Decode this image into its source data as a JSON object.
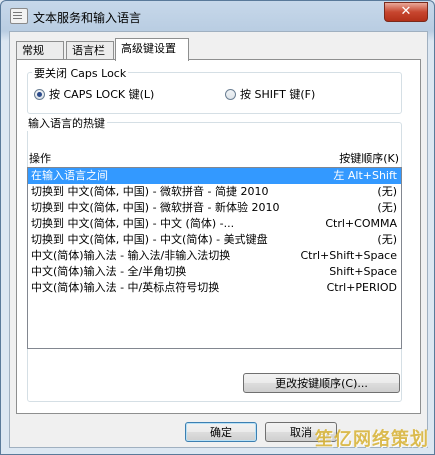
{
  "window": {
    "title": "文本服务和输入语言",
    "close_glyph": "✕"
  },
  "tabs": [
    {
      "label": "常规"
    },
    {
      "label": "语言栏"
    },
    {
      "label": "高级键设置"
    }
  ],
  "caps_group": {
    "title": "要关闭 Caps Lock",
    "option_caps": "按 CAPS LOCK 键(L)",
    "option_shift": "按 SHIFT 键(F)",
    "selected": "caps"
  },
  "hotkeys_group": {
    "title": "输入语言的热键",
    "col_action": "操作",
    "col_keys": "按键顺序(K)",
    "rows": [
      {
        "action": "在输入语言之间",
        "keys": "左 Alt+Shift",
        "selected": true
      },
      {
        "action": "切换到 中文(简体, 中国) - 微软拼音 - 简捷 2010",
        "keys": "(无)"
      },
      {
        "action": "切换到 中文(简体, 中国) - 微软拼音 - 新体验 2010",
        "keys": "(无)"
      },
      {
        "action": "切换到 中文(简体, 中国) - 中文 (简体) -...",
        "keys": "Ctrl+COMMA"
      },
      {
        "action": "切换到 中文(简体, 中国) - 中文(简体) - 美式键盘",
        "keys": "(无)"
      },
      {
        "action": "中文(简体)输入法 - 输入法/非输入法切换",
        "keys": "Ctrl+Shift+Space"
      },
      {
        "action": "中文(简体)输入法 - 全/半角切换",
        "keys": "Shift+Space"
      },
      {
        "action": "中文(简体)输入法 - 中/英标点符号切换",
        "keys": "Ctrl+PERIOD"
      }
    ],
    "change_button": "更改按键顺序(C)..."
  },
  "footer": {
    "ok_label": "确定",
    "cancel_label": "取消"
  },
  "watermark": "笙亿网络策划"
}
